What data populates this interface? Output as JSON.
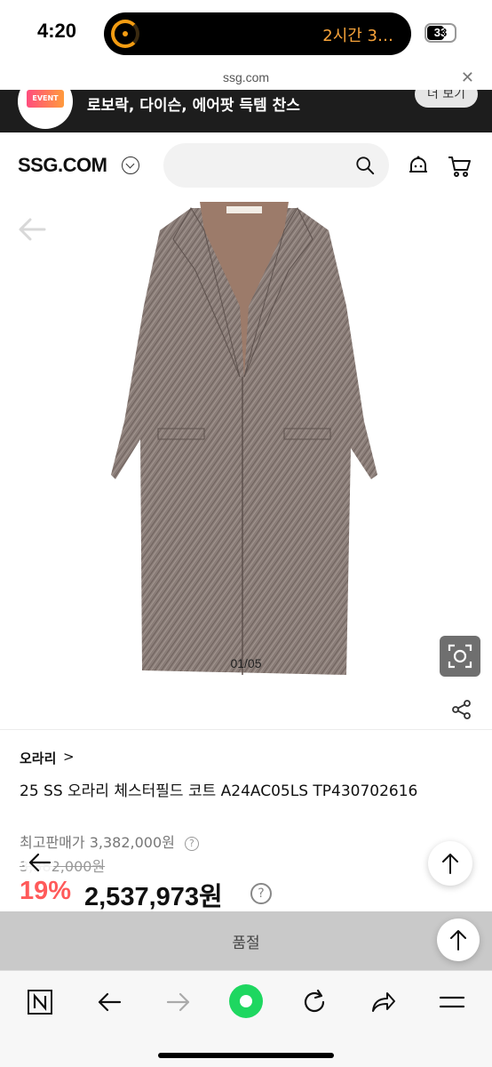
{
  "status_bar": {
    "time": "4:20",
    "live_activity_text": "2시간 3…",
    "battery_level": "33"
  },
  "url_bar": {
    "url": "ssg.com",
    "close_icon": "close-icon"
  },
  "banner": {
    "badge_text": "EVENT",
    "text": "로보락, 다이슨, 에어팟 득템 찬스",
    "button_label": "더 보기"
  },
  "header": {
    "logo": "SSG.COM",
    "search_placeholder": "",
    "icons": [
      "search-icon",
      "bell-icon",
      "cart-icon"
    ]
  },
  "gallery": {
    "page_indicator": "01/05",
    "icons": [
      "back-arrow-icon",
      "lens-search-icon",
      "share-icon"
    ]
  },
  "product": {
    "brand": "오라리",
    "brand_arrow": ">",
    "name": "25 SS 오라리 체스터필드 코트 A24AC05LS TP430702616",
    "max_price_label": "최고판매가",
    "max_price": "3,382,000원",
    "original_price": "3,382,000원",
    "discount": "19%",
    "sale_price": "2,537,973원",
    "info_symbol": "?"
  },
  "soldout": {
    "label": "품절"
  },
  "toolbar": {
    "icons": [
      "naver-icon",
      "back-icon",
      "forward-icon",
      "green-dot-icon",
      "refresh-icon",
      "share-icon",
      "menu-icon"
    ]
  },
  "colors": {
    "discount_red": "#ff5a5a",
    "banner_bg": "#1d1d1d",
    "island_text": "#f7a33a",
    "green_button": "#1ed760"
  }
}
